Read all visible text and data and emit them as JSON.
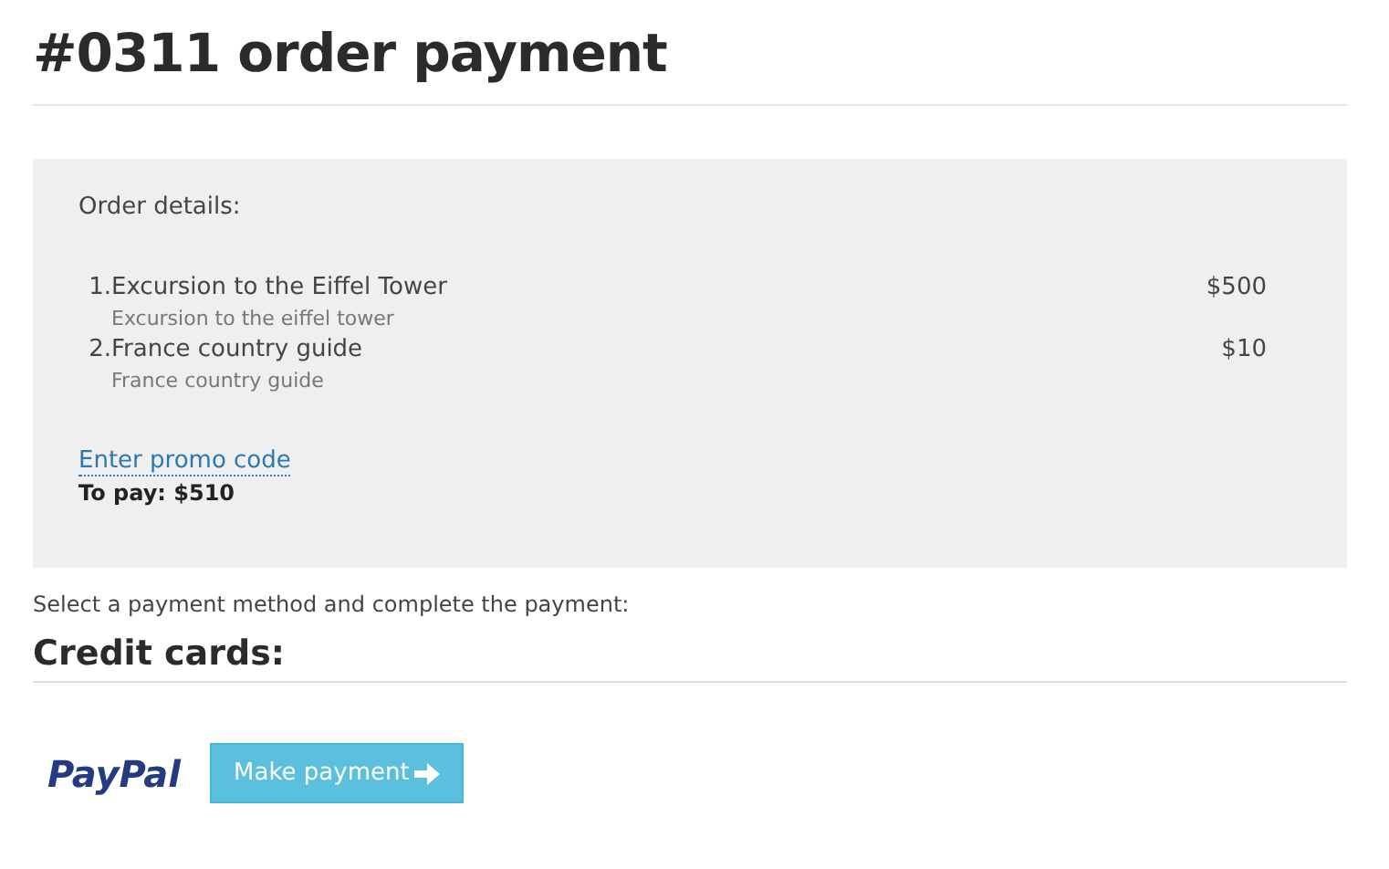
{
  "title": "#0311 order payment",
  "order": {
    "heading": "Order details:",
    "items": [
      {
        "number": "1.",
        "name": "Excursion to the Eiffel Tower",
        "description": "Excursion to the eiffel tower",
        "price": "$500"
      },
      {
        "number": "2.",
        "name": "France country guide",
        "description": "France country guide",
        "price": "$10"
      }
    ],
    "promo_link": "Enter promo code",
    "total": "To pay: $510"
  },
  "instruction": "Select a payment method and complete the payment:",
  "section_title": "Credit cards:",
  "payment": {
    "logo": "PayPal",
    "button": "Make payment"
  }
}
